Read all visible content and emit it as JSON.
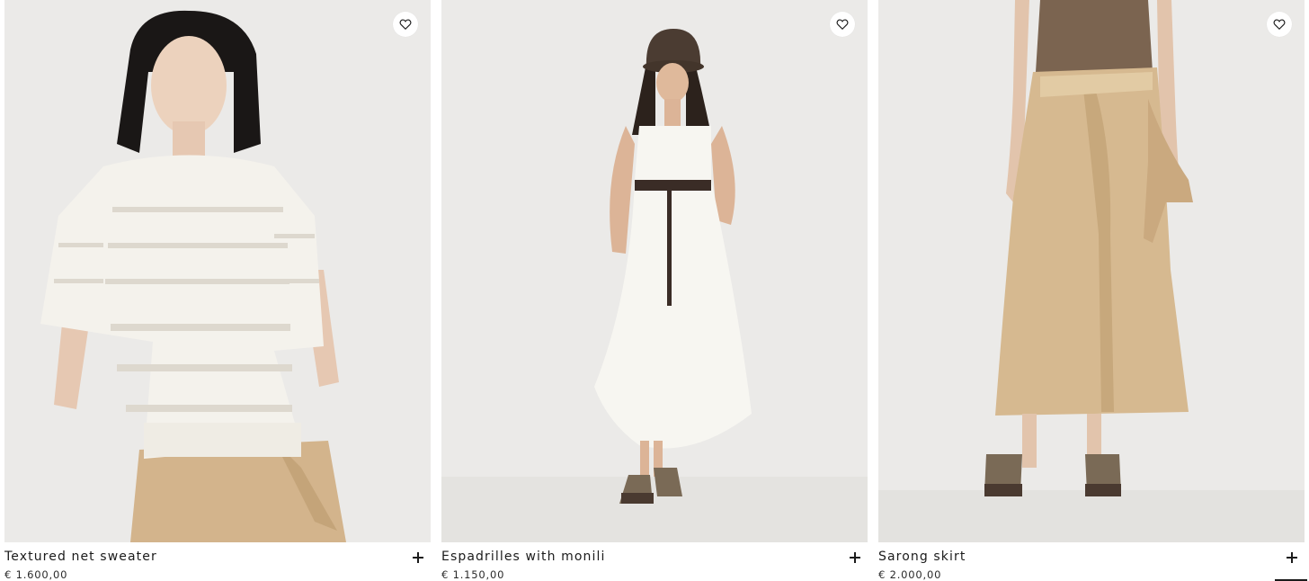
{
  "products": [
    {
      "name": "Textured net sweater",
      "price": "€ 1.600,00",
      "image": "woman-white-crochet-sweater-photo",
      "wishlist_icon": "heart-icon",
      "add_icon": "plus-icon"
    },
    {
      "name": "Espadrilles with monili",
      "price": "€ 1.150,00",
      "image": "woman-white-dress-bucket-hat-photo",
      "wishlist_icon": "heart-icon",
      "add_icon": "plus-icon"
    },
    {
      "name": "Sarong skirt",
      "price": "€ 2.000,00",
      "image": "beige-sarong-skirt-photo",
      "wishlist_icon": "heart-icon",
      "add_icon": "plus-icon"
    }
  ],
  "colors": {
    "photo_background": "#ebeae8",
    "text": "#1b1b1b",
    "skirt_beige": "#d6b990",
    "sweater_white": "#f4f2ec"
  }
}
